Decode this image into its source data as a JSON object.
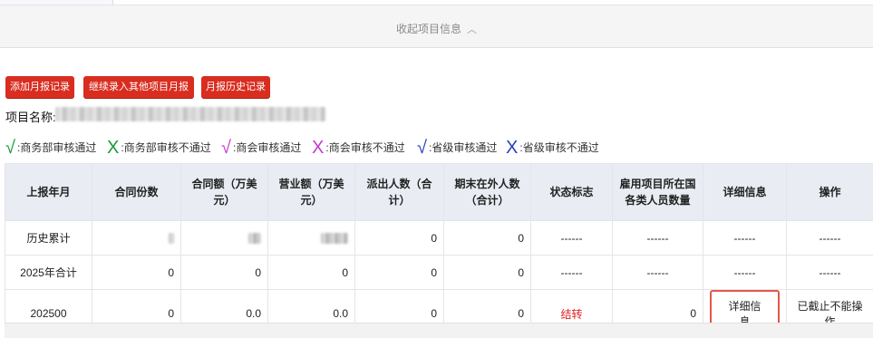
{
  "collapse": {
    "label": "收起项目信息",
    "icon": "chevron-up-icon"
  },
  "buttons": {
    "add_monthly": "添加月报记录",
    "continue_other": "继续录入其他项目月报",
    "history": "月报历史记录"
  },
  "project": {
    "label": "项目名称"
  },
  "legend": [
    {
      "mark": "√",
      "text": "商务部审核通过",
      "color": "#1a9a3a"
    },
    {
      "mark": "X",
      "text": "商务部审核不通过",
      "color": "#1a9a3a"
    },
    {
      "mark": "√",
      "text": "商会审核通过",
      "color": "#c43ad0"
    },
    {
      "mark": "X",
      "text": "商会审核不通过",
      "color": "#c43ad0"
    },
    {
      "mark": "√",
      "text": "省级审核通过",
      "color": "#2b3fb8"
    },
    {
      "mark": "X",
      "text": "省级审核不通过",
      "color": "#2b3fb8"
    }
  ],
  "legend_sep": ":",
  "table": {
    "headers": [
      "上报年月",
      "合同份数",
      "合同额（万美元）",
      "营业额（万美元）",
      "派出人数（合计）",
      "期末在外人数（合计）",
      "状态标志",
      "雇用项目所在国各类人员数量",
      "详细信息",
      "操作"
    ],
    "rows": [
      {
        "period": "历史累计",
        "contracts": "",
        "contract_amount": "",
        "revenue": "",
        "dispatched": "0",
        "abroad": "0",
        "status": "------",
        "local_staff": "------",
        "detail": "------",
        "action": "------"
      },
      {
        "period": "2025年合计",
        "contracts": "0",
        "contract_amount": "0",
        "revenue": "0",
        "dispatched": "0",
        "abroad": "0",
        "status": "------",
        "local_staff": "------",
        "detail": "------",
        "action": "------"
      },
      {
        "period": "202500",
        "contracts": "0",
        "contract_amount": "0.0",
        "revenue": "0.0",
        "dispatched": "0",
        "abroad": "0",
        "status": "结转",
        "local_staff": "0",
        "detail": "详细信息",
        "action": "已截止不能操作"
      }
    ]
  },
  "colors": {
    "button_red": "#d92d20",
    "status_red": "#e02020",
    "header_bg": "#e9edf3"
  }
}
